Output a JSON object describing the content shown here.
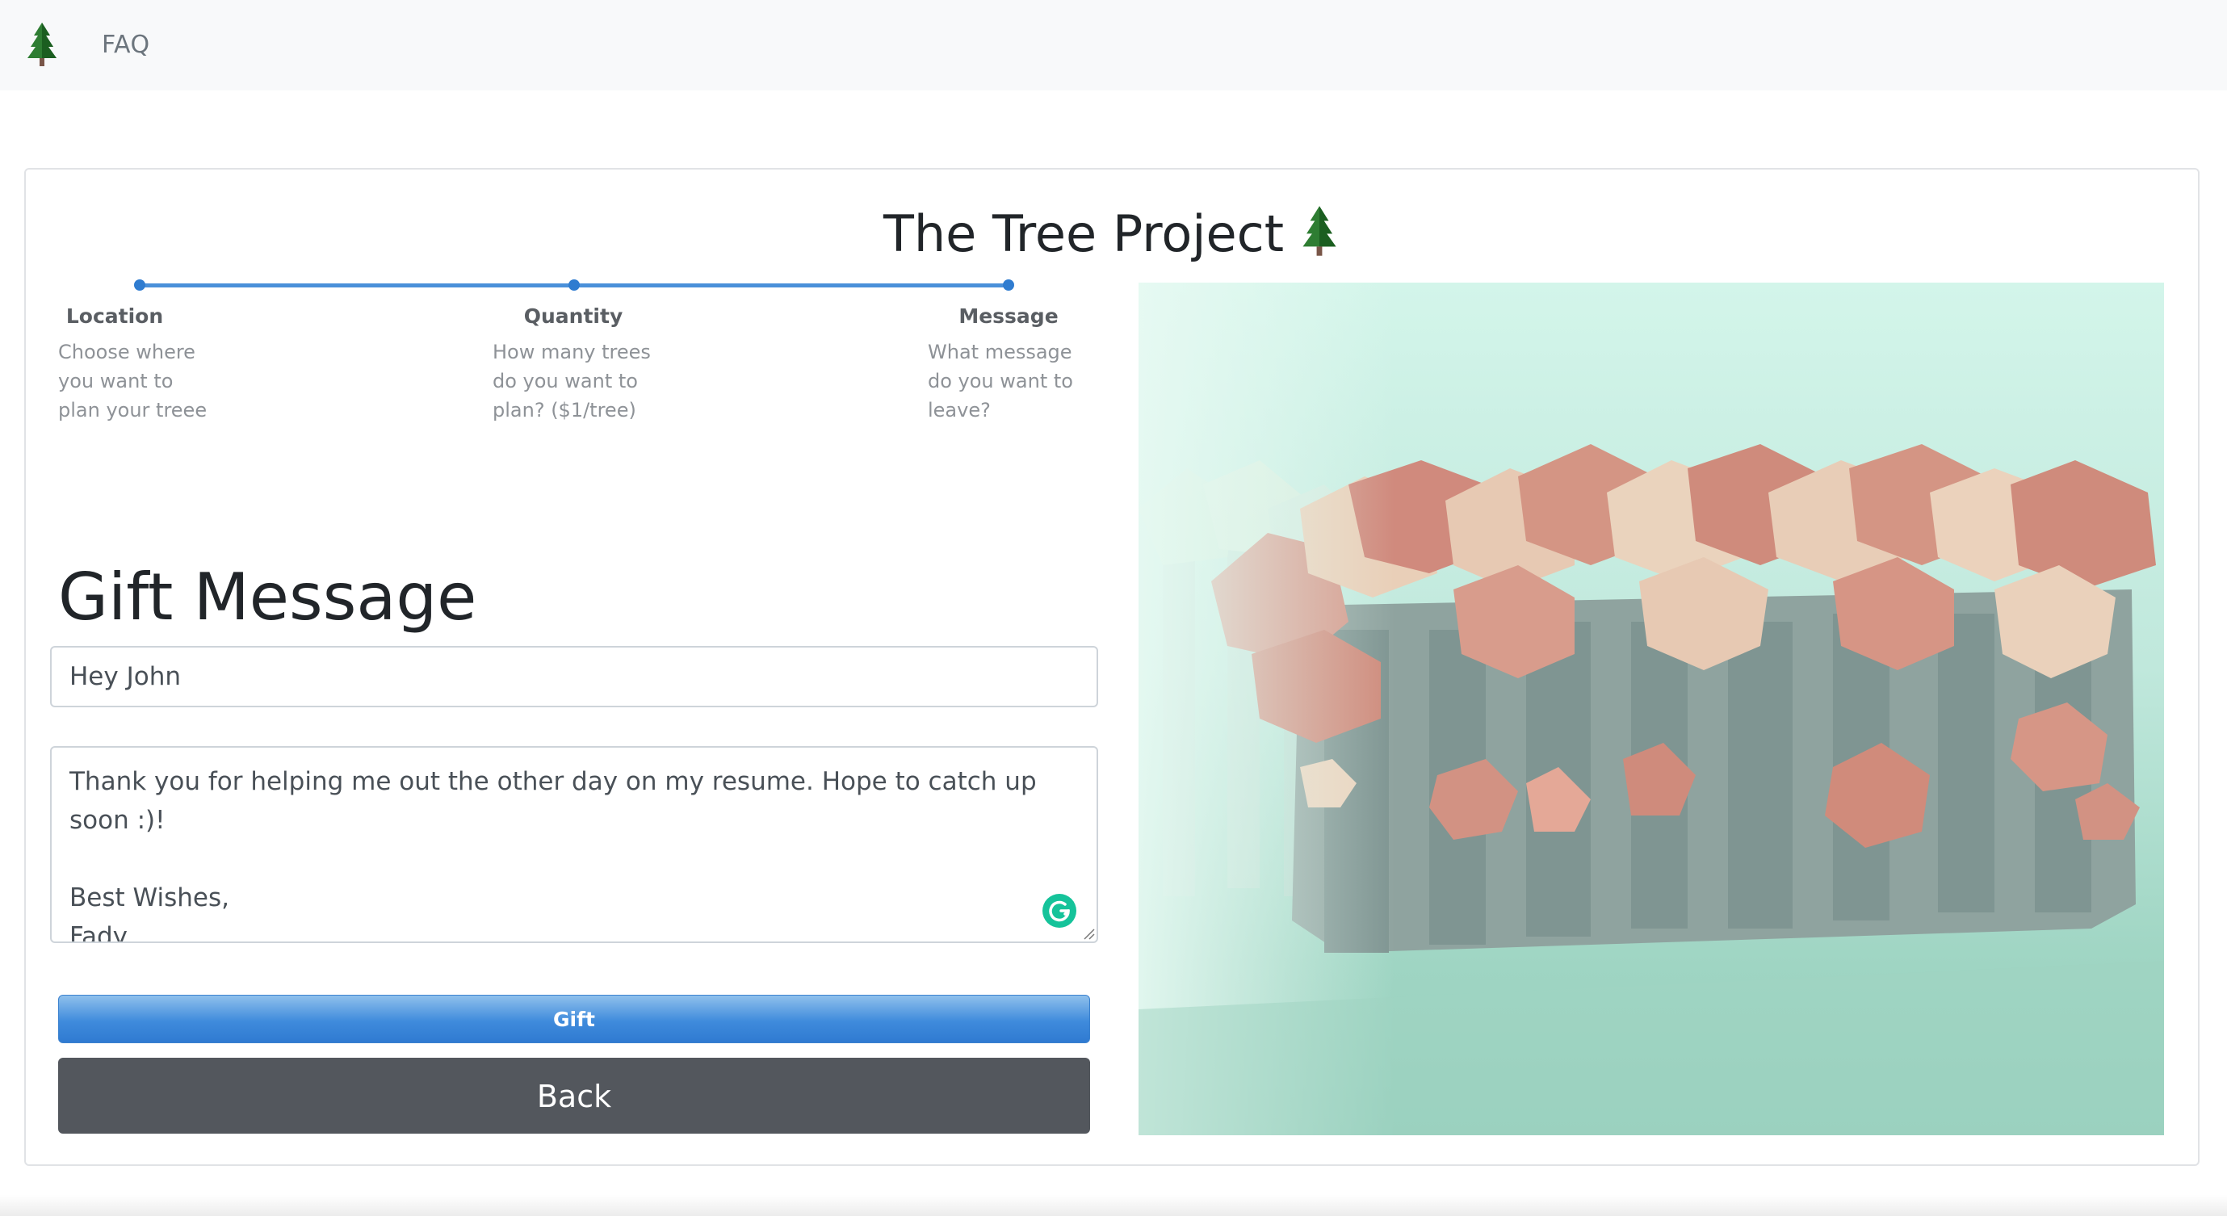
{
  "nav": {
    "brand_icon": "tree-icon",
    "faq_label": "FAQ"
  },
  "card": {
    "title": "The Tree Project",
    "title_icon": "tree-icon"
  },
  "stepper": {
    "progress_fraction": 1.0,
    "steps": [
      {
        "title": "Location",
        "description": "Choose where you want to plan your treee"
      },
      {
        "title": "Quantity",
        "description": "How many trees do you want to plan? ($1/tree)"
      },
      {
        "title": "Message",
        "description": "What message do you want to leave?"
      }
    ]
  },
  "form": {
    "heading": "Gift Message",
    "recipient_value": "Hey John",
    "message_value": "Thank you for helping me out the other day on my resume. Hope to catch up soon :)!\n\nBest Wishes,\nFady",
    "gift_label": "Gift",
    "back_label": "Back"
  },
  "colors": {
    "accent_blue": "#3f8bdc",
    "back_gray": "#53575d",
    "navbar_bg": "#f8f9fa",
    "grammarly_green": "#15c39a"
  },
  "scene": {
    "icon": "low-poly-forest-illustration"
  }
}
